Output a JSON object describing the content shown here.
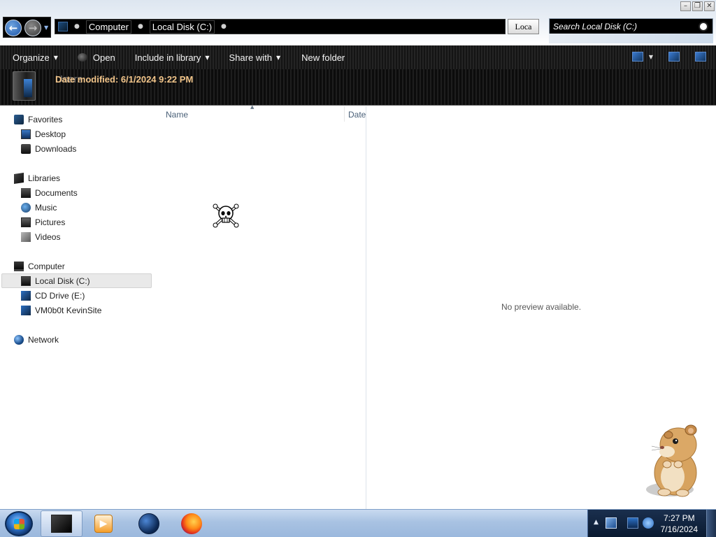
{
  "window": {
    "controls": [
      "minimize",
      "restore",
      "close"
    ],
    "control_glyphs": [
      "–",
      "❐",
      "✕"
    ]
  },
  "address_bar": {
    "breadcrumbs": [
      "Computer",
      "Local Disk (C:)"
    ],
    "recent_button_label": "Loca",
    "search_placeholder": "Search Local Disk (C:)"
  },
  "toolbar": {
    "organize": "Organize",
    "open": "Open",
    "include_in_library": "Include in library",
    "share_with": "Share with",
    "new_folder": "New folder"
  },
  "details_pane": {
    "item_name": "Users",
    "date_modified_label": "Date modified:",
    "date_modified_value": "6/1/2024 9:22 PM"
  },
  "nav_pane": {
    "favorites": {
      "label": "Favorites",
      "items": [
        "Desktop",
        "Downloads"
      ]
    },
    "libraries": {
      "label": "Libraries",
      "items": [
        "Documents",
        "Music",
        "Pictures",
        "Videos"
      ]
    },
    "computer": {
      "label": "Computer",
      "items": [
        "Local Disk (C:)",
        "CD Drive (E:)",
        "VM0b0t KevinSite"
      ],
      "selected": "Local Disk (C:)"
    },
    "network": {
      "label": "Network"
    }
  },
  "file_list": {
    "columns": [
      "Name",
      "Date"
    ]
  },
  "preview_pane": {
    "message": "No preview available."
  },
  "taskbar": {
    "pinned": [
      "windows-explorer-icon",
      "media-player-icon",
      "globe-icon",
      "firefox-icon"
    ],
    "clock": {
      "time": "7:27 PM",
      "date": "7/16/2024"
    }
  },
  "colors": {
    "toolbar_bg": "#1d1d1d",
    "details_text": "#f2c58a",
    "taskbar": "#a8c2e2",
    "tray": "#0a1a30"
  }
}
